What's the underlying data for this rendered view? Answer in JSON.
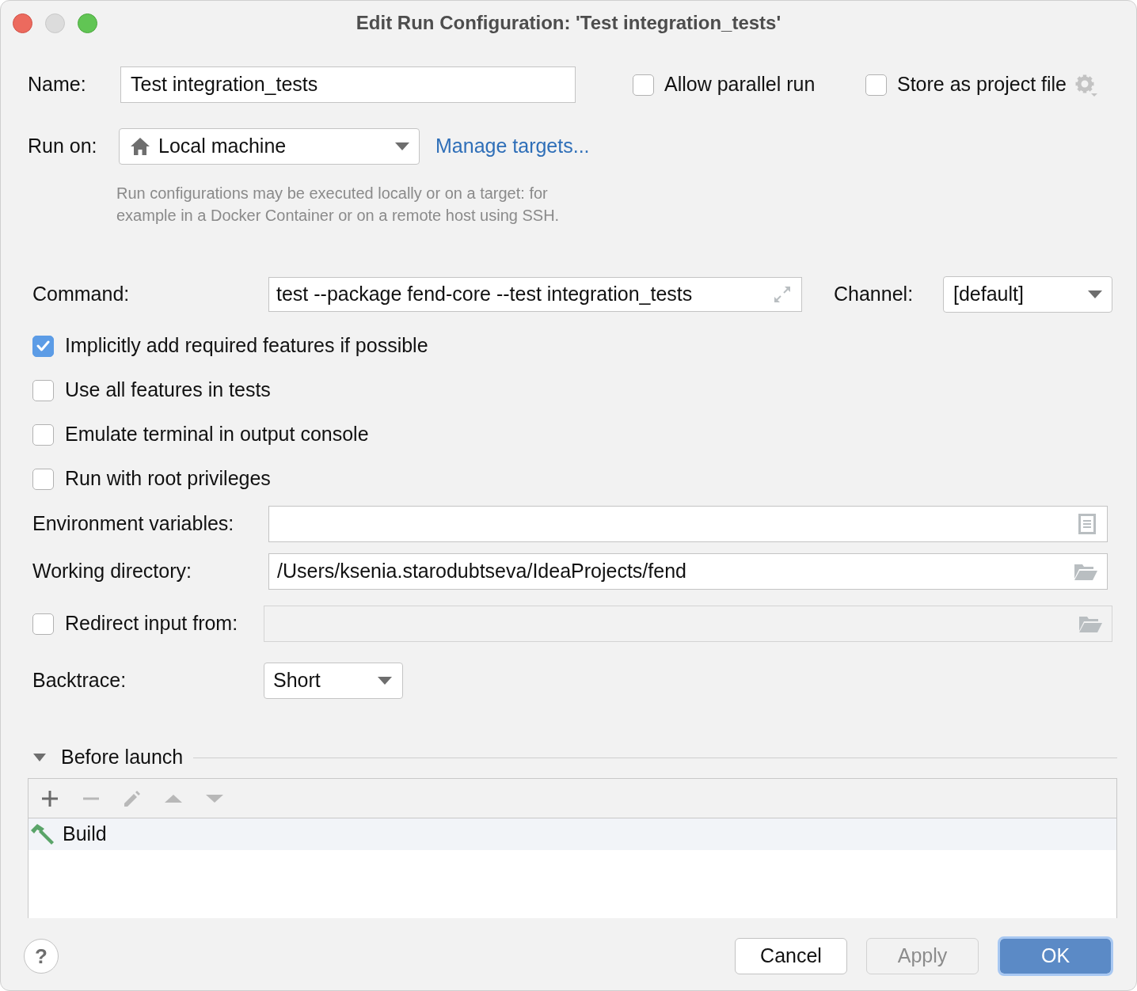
{
  "window": {
    "title": "Edit Run Configuration: 'Test integration_tests'",
    "controls": [
      {
        "kind": "close",
        "disabled": false
      },
      {
        "kind": "minimize",
        "disabled": true
      },
      {
        "kind": "zoom",
        "disabled": false
      }
    ]
  },
  "name_field": {
    "label": "Name:",
    "value": "Test integration_tests"
  },
  "header_options": [
    {
      "label": "Allow parallel run",
      "checked": false
    },
    {
      "label": "Store as project file",
      "checked": false
    }
  ],
  "run_on": {
    "label": "Run on:",
    "value": "Local machine",
    "link": "Manage targets...",
    "hint": "Run configurations may be executed locally or on a target: for\nexample in a Docker Container or on a remote host using SSH."
  },
  "command": {
    "label": "Command:",
    "value": "test --package fend-core --test integration_tests"
  },
  "channel": {
    "label": "Channel:",
    "value": "[default]"
  },
  "options": [
    {
      "label": "Implicitly add required features if possible",
      "checked": true
    },
    {
      "label": "Use all features in tests",
      "checked": false
    },
    {
      "label": "Emulate terminal in output console",
      "checked": false
    },
    {
      "label": "Run with root privileges",
      "checked": false
    }
  ],
  "environment_variables": {
    "label": "Environment variables:"
  },
  "working_directory": {
    "label": "Working directory:",
    "value": "/Users/ksenia.starodubtseva/IdeaProjects/fend"
  },
  "redirect_input": {
    "label": "Redirect input from:",
    "checked": false,
    "disabled": true
  },
  "backtrace": {
    "label": "Backtrace:",
    "value": "Short"
  },
  "before_launch": {
    "title": "Before launch",
    "expanded": true,
    "toolbar": [
      {
        "kind": "add",
        "disabled": false
      },
      {
        "kind": "remove",
        "disabled": true
      },
      {
        "kind": "edit",
        "disabled": true
      },
      {
        "kind": "move_up",
        "disabled": true
      },
      {
        "kind": "move_down",
        "disabled": true
      }
    ],
    "tasks": [
      {
        "label": "Build",
        "selected": true
      }
    ]
  },
  "footer": {
    "help": "?",
    "buttons": [
      {
        "label": "Cancel",
        "default": false,
        "disabled": false
      },
      {
        "label": "Apply",
        "default": false,
        "disabled": true
      },
      {
        "label": "OK",
        "default": true,
        "disabled": false
      }
    ]
  }
}
